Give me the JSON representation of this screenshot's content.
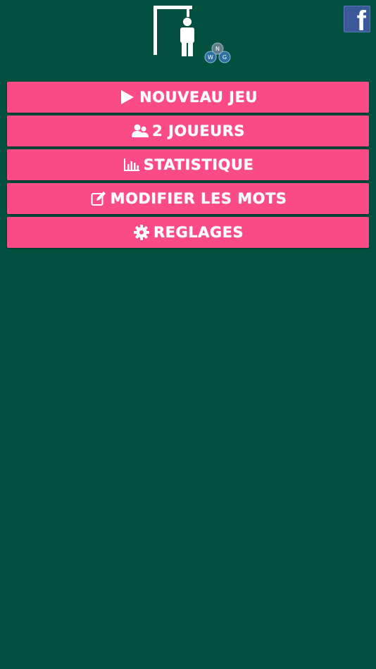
{
  "app": {
    "logo_icon": "hangman-gallows-icon",
    "badge_icon": "nwg-molecule-icon",
    "badge_letters": [
      "N",
      "W",
      "G"
    ]
  },
  "share": {
    "icon": "facebook-icon",
    "letter": "f",
    "color": "#3b5998"
  },
  "menu": {
    "button_color": "#fa4b86",
    "items": [
      {
        "icon": "play-icon",
        "label": "NOUVEAU JEU"
      },
      {
        "icon": "users-icon",
        "label": "2 JOUEURS"
      },
      {
        "icon": "bar-chart-icon",
        "label": "STATISTIQUE"
      },
      {
        "icon": "edit-icon",
        "label": "MODIFIER LES MOTS"
      },
      {
        "icon": "gear-icon",
        "label": "REGLAGES"
      }
    ]
  },
  "theme": {
    "background": "#02503f",
    "text": "#ffffff"
  }
}
